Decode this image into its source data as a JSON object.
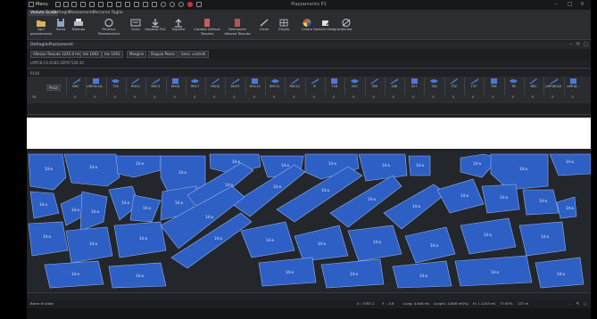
{
  "window": {
    "title": "Piazzamento P1",
    "menu_label": "Menu"
  },
  "ribbon_tabs": [
    "Vedute Scale",
    "Dettaglio",
    "Piazzamento",
    "Percorso Taglio"
  ],
  "ribbon_buttons": [
    {
      "label": "Apri piazzamento",
      "icon": "open-folder-icon"
    },
    {
      "label": "Salva",
      "icon": "save-icon"
    },
    {
      "label": "Stampa",
      "icon": "print-icon"
    },
    {
      "label": "Ricarica Piazzamento",
      "icon": "reload-icon"
    },
    {
      "label": "Invia",
      "icon": "send-icon"
    },
    {
      "label": "Importa PLX",
      "icon": "import-icon"
    },
    {
      "label": "Esporta",
      "icon": "export-icon"
    },
    {
      "label": "Cambia Altezza Tessuto",
      "icon": "fabric-height-icon"
    },
    {
      "label": "Reimporta Altezza Tessuto",
      "icon": "reimport-height-icon"
    },
    {
      "label": "Linee",
      "icon": "lines-icon"
    },
    {
      "label": "Griglia",
      "icon": "grid-icon"
    },
    {
      "label": "Colore",
      "icon": "color-wheel-icon"
    },
    {
      "label": "Opzioni disegno",
      "icon": "draw-options-icon"
    },
    {
      "label": "Allinea",
      "icon": "align-icon"
    }
  ],
  "document": {
    "title": "DettaglioPiazzamenti"
  },
  "params": {
    "altezza": "Altezza Tessuto 1245.0 mm",
    "idx_a": "Idx 1063",
    "idx_b": "Idx 1063",
    "margine": "Margine",
    "doppia": "Doppia Pezza",
    "controlli": "Senz. controll."
  },
  "subtitle": "LMP18-CA-0183-30P07126-30",
  "position_label": "P100",
  "pieces_table": {
    "header": "Pezzi",
    "row_label": "34",
    "columns": [
      "BHC",
      "LMP18-CA...",
      "T2S",
      "RHC2",
      "RHC3",
      "RHC6",
      "RHC7",
      "RHC8",
      "RHC9",
      "RHC10",
      "RHC11",
      "RHC12",
      "R",
      "T2B",
      "2X0",
      "T3B",
      "2X8",
      "2X7",
      "T28",
      "T32",
      "T37",
      "T38",
      "T8",
      "RR1",
      "LMP18CA3",
      "LMP18..."
    ],
    "values": [
      "0",
      "0",
      "0",
      "0",
      "0",
      "0",
      "0",
      "0",
      "0",
      "0",
      "0",
      "0",
      "0",
      "0",
      "0",
      "0",
      "0",
      "0",
      "0",
      "0",
      "0",
      "0",
      "0",
      "0",
      "0",
      "0"
    ]
  },
  "marker": {
    "piece_label": "14-a",
    "piece_color": "#2e5fc4",
    "piece_border": "#8fb2f0",
    "background": "#23262b"
  },
  "status": {
    "panel_label": "Barra di stato",
    "x": "X : 3787.2",
    "y": "Y : -3.8",
    "lung": "Lung: 4.846 mt",
    "lung2": "Lung%: 4.846 mt(%)",
    "h": "H: 1.1243 mt",
    "eff": "77.65%",
    "extra": "137 m"
  }
}
